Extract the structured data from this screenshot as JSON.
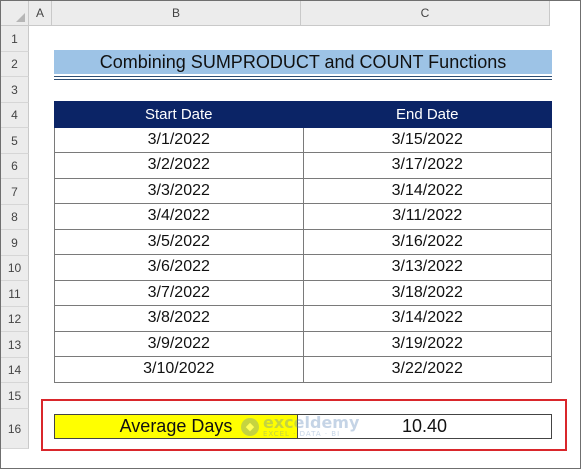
{
  "sheet": {
    "columns": [
      "A",
      "B",
      "C"
    ],
    "rows": [
      "1",
      "2",
      "3",
      "4",
      "5",
      "6",
      "7",
      "8",
      "9",
      "10",
      "11",
      "12",
      "13",
      "14",
      "15",
      "16"
    ]
  },
  "title": "Combining SUMPRODUCT and COUNT Functions",
  "table": {
    "headers": [
      "Start  Date",
      "End Date"
    ],
    "rows": [
      [
        "3/1/2022",
        "3/15/2022"
      ],
      [
        "3/2/2022",
        "3/17/2022"
      ],
      [
        "3/3/2022",
        "3/14/2022"
      ],
      [
        "3/4/2022",
        "3/11/2022"
      ],
      [
        "3/5/2022",
        "3/16/2022"
      ],
      [
        "3/6/2022",
        "3/13/2022"
      ],
      [
        "3/7/2022",
        "3/18/2022"
      ],
      [
        "3/8/2022",
        "3/14/2022"
      ],
      [
        "3/9/2022",
        "3/19/2022"
      ],
      [
        "3/10/2022",
        "3/22/2022"
      ]
    ]
  },
  "result": {
    "label": "Average Days",
    "value": "10.40"
  },
  "watermark": {
    "name": "exceldemy",
    "tagline": "EXCEL · DATA · BI"
  },
  "colors": {
    "title_bg": "#9dc3e6",
    "header_bg": "#0b2466",
    "label_bg": "#ffff00",
    "highlight_border": "#d9262b"
  }
}
